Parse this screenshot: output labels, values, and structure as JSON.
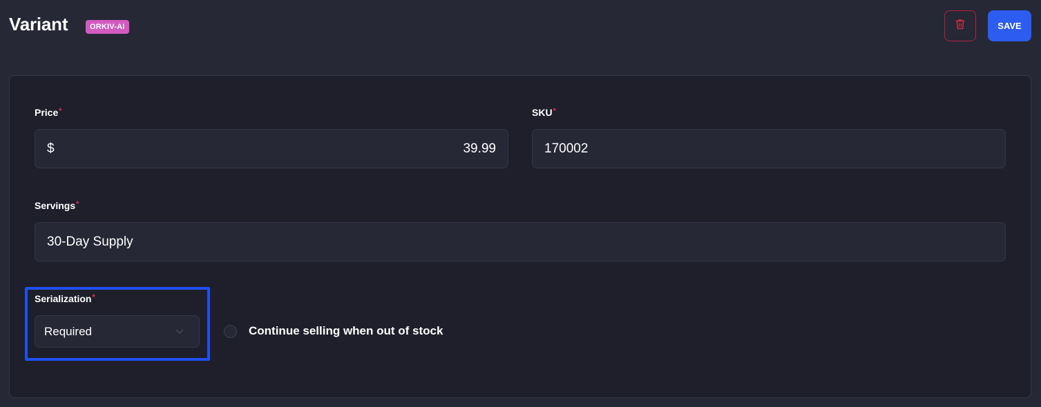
{
  "header": {
    "title": "Variant",
    "badge": "ORKIV-AI",
    "delete_icon": "trash-icon",
    "save_label": "SAVE"
  },
  "form": {
    "price": {
      "label": "Price",
      "required_mark": "*",
      "currency": "$",
      "value": "39.99"
    },
    "sku": {
      "label": "SKU",
      "required_mark": "*",
      "value": "170002"
    },
    "servings": {
      "label": "Servings",
      "required_mark": "*",
      "value": "30-Day Supply"
    },
    "serialization": {
      "label": "Serialization",
      "required_mark": "*",
      "selected": "Required",
      "icon": "chevron-down-icon"
    },
    "continue_selling": {
      "label": "Continue selling when out of stock",
      "checked": false
    }
  },
  "colors": {
    "background": "#262836",
    "card": "#1e1f2b",
    "badge": "#d35bc0",
    "save": "#2d5cf0",
    "delete_border": "#b3213d",
    "required": "#e0334f",
    "highlight": "#2150f1"
  }
}
